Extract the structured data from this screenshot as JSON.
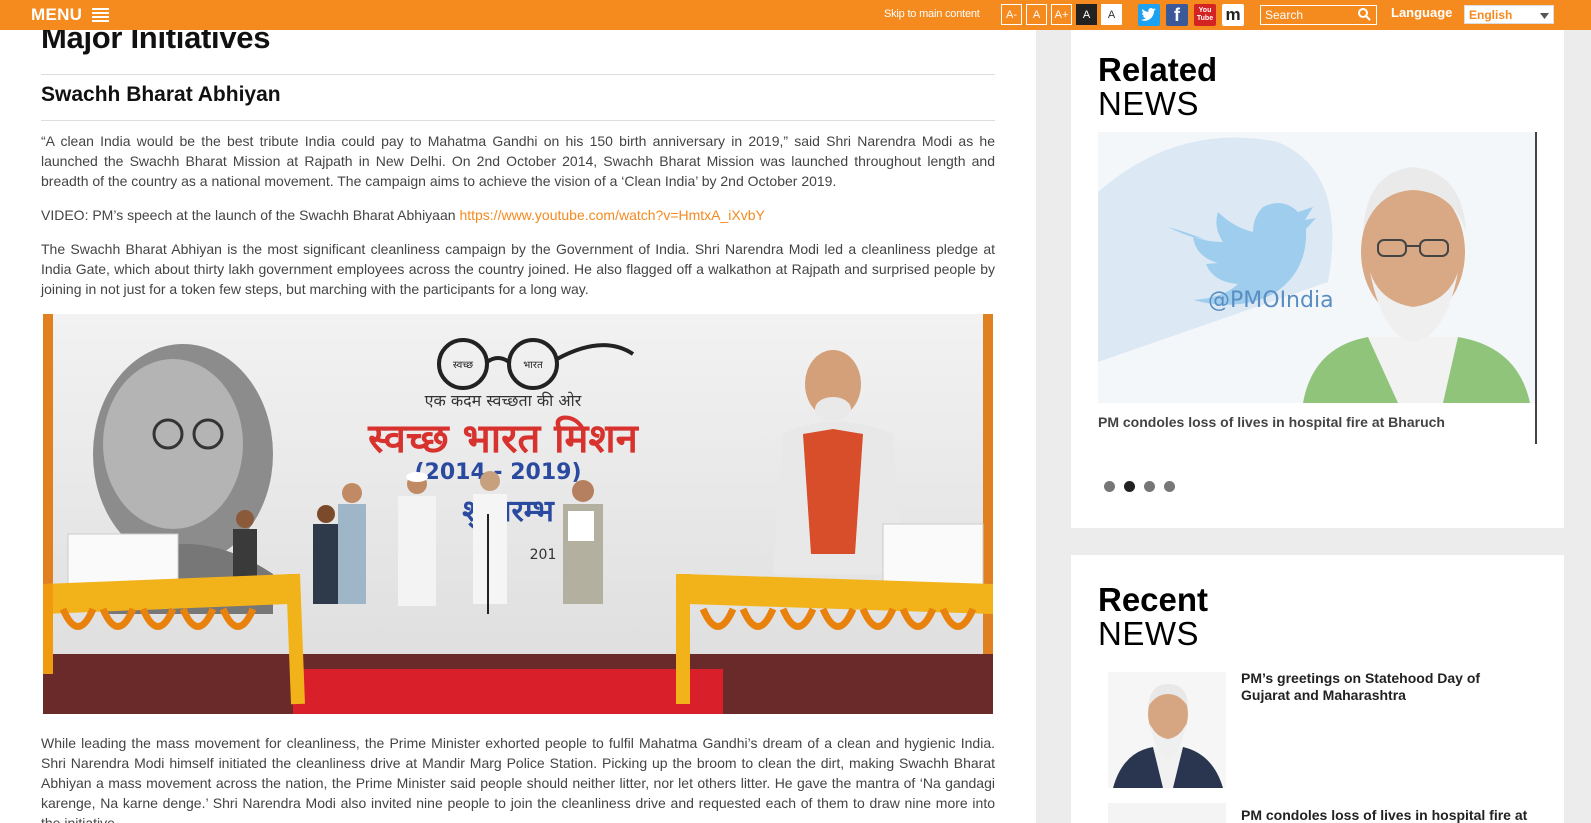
{
  "topbar": {
    "menu_label": "MENU",
    "skip_label": "Skip to main content",
    "font_buttons": [
      "A-",
      "A",
      "A+",
      "A",
      "A"
    ],
    "social": [
      {
        "name": "twitter",
        "glyph": "t",
        "color": "#1da1f2"
      },
      {
        "name": "facebook",
        "glyph": "f",
        "color": "#3b5998"
      },
      {
        "name": "youtube",
        "glyph": "You Tube",
        "color": "#d32323"
      },
      {
        "name": "narendra-modi-app",
        "glyph": "m",
        "color": "#ffffff"
      }
    ],
    "search_placeholder": "Search",
    "language_label": "Language",
    "language_value": "English",
    "accent_color": "#f58a1f"
  },
  "main": {
    "page_title": "Major Initiatives",
    "section_title": "Swachh Bharat Abhiyan",
    "para1": "“A clean India would be the best tribute India could pay to Mahatma Gandhi on his 150 birth anniversary in 2019,” said Shri Narendra Modi as he launched the Swachh Bharat Mission at Rajpath in New Delhi. On 2nd October 2014, Swachh Bharat Mission was launched throughout length and breadth of the country as a national movement. The campaign aims to achieve the vision of a ‘Clean India’ by 2nd October 2019.",
    "video_prefix": "VIDEO: PM’s speech at the launch of the Swachh Bharat Abhiyaan ",
    "video_link": "https://www.youtube.com/watch?v=HmtxA_iXvbY",
    "para2": "The Swachh Bharat Abhiyan is the most significant cleanliness campaign by the Government of India. Shri Narendra Modi led a cleanliness pledge at India Gate, which about thirty lakh government employees across the country joined. He also flagged off a walkathon at Rajpath and surprised people by joining in not just for a token few steps, but marching with the participants for a long way.",
    "hero_banner": {
      "tagline": "एक कदम स्वच्छता की ओर",
      "title": "स्वच्छ भारत मिशन",
      "years": "(2014 - 2019)",
      "start": "शुभारम्भ",
      "glasses_left": "स्वच्छ",
      "glasses_right": "भारत",
      "date_frag": "201"
    },
    "para3": "While leading the mass movement for cleanliness, the Prime Minister exhorted people to fulfil Mahatma Gandhi’s dream of a clean and hygienic India. Shri Narendra Modi himself initiated the cleanliness drive at Mandir Marg Police Station. Picking up the broom to clean the dirt, making Swachh Bharat Abhiyan a mass movement across the nation, the Prime Minister said people should neither litter, nor let others litter. He gave the mantra of ‘Na gandagi karenge, Na karne denge.’ Shri Narendra Modi also invited nine people to join the cleanliness drive and requested each of them to draw nine more into the initiative."
  },
  "related": {
    "heading_bold": "Related",
    "heading_light": "NEWS",
    "image_handle": "@PMOIndia",
    "caption": "PM condoles loss of lives in hospital fire at Bharuch",
    "dots": 4,
    "active_dot": 1
  },
  "recent": {
    "heading_bold": "Recent",
    "heading_light": "NEWS",
    "items": [
      {
        "title": "PM’s greetings on Statehood Day of Gujarat and Maharashtra"
      },
      {
        "title": "PM condoles loss of lives in hospital fire at"
      }
    ]
  }
}
